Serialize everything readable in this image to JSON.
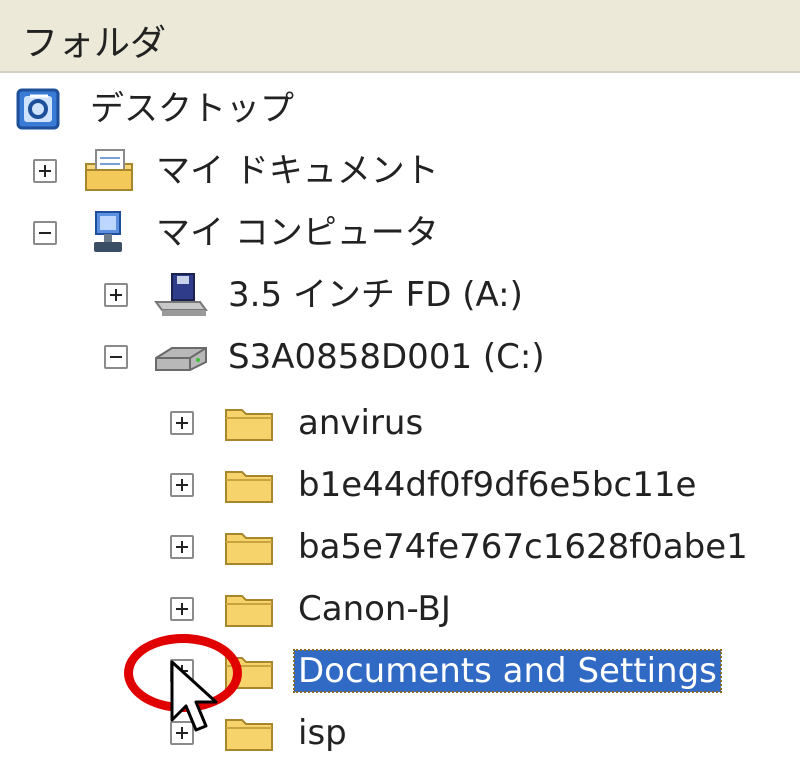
{
  "header": {
    "title": "フォルダ"
  },
  "tree": {
    "desktop": "デスクトップ",
    "my_documents": "マイ ドキュメント",
    "my_computer": "マイ コンピュータ",
    "floppy": "3.5 インチ FD (A:)",
    "c_drive": "S3A0858D001 (C:)",
    "folders": [
      "anvirus",
      "b1e44df0f9df6e5bc11e",
      "ba5e74fe767c1628f0abe1",
      "Canon-BJ",
      "Documents and Settings",
      "isp"
    ]
  },
  "highlight": {
    "color": "#e10000"
  },
  "selection": {
    "color": "#316ac5"
  }
}
